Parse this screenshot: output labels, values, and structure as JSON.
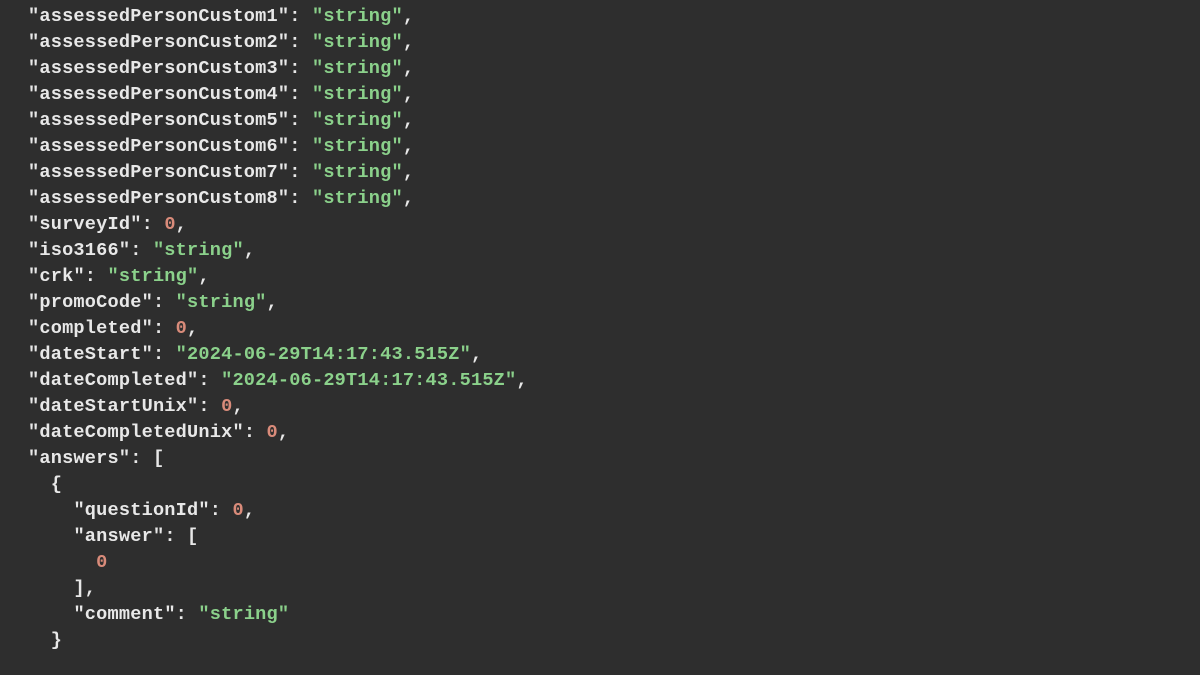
{
  "lines": [
    {
      "indent": 0,
      "key": "assessedPersonCustom1",
      "valueType": "string",
      "value": "string",
      "trailingComma": true
    },
    {
      "indent": 0,
      "key": "assessedPersonCustom2",
      "valueType": "string",
      "value": "string",
      "trailingComma": true
    },
    {
      "indent": 0,
      "key": "assessedPersonCustom3",
      "valueType": "string",
      "value": "string",
      "trailingComma": true
    },
    {
      "indent": 0,
      "key": "assessedPersonCustom4",
      "valueType": "string",
      "value": "string",
      "trailingComma": true
    },
    {
      "indent": 0,
      "key": "assessedPersonCustom5",
      "valueType": "string",
      "value": "string",
      "trailingComma": true
    },
    {
      "indent": 0,
      "key": "assessedPersonCustom6",
      "valueType": "string",
      "value": "string",
      "trailingComma": true
    },
    {
      "indent": 0,
      "key": "assessedPersonCustom7",
      "valueType": "string",
      "value": "string",
      "trailingComma": true
    },
    {
      "indent": 0,
      "key": "assessedPersonCustom8",
      "valueType": "string",
      "value": "string",
      "trailingComma": true
    },
    {
      "indent": 0,
      "key": "surveyId",
      "valueType": "number",
      "value": "0",
      "trailingComma": true
    },
    {
      "indent": 0,
      "key": "iso3166",
      "valueType": "string",
      "value": "string",
      "trailingComma": true
    },
    {
      "indent": 0,
      "key": "crk",
      "valueType": "string",
      "value": "string",
      "trailingComma": true
    },
    {
      "indent": 0,
      "key": "promoCode",
      "valueType": "string",
      "value": "string",
      "trailingComma": true
    },
    {
      "indent": 0,
      "key": "completed",
      "valueType": "number",
      "value": "0",
      "trailingComma": true
    },
    {
      "indent": 0,
      "key": "dateStart",
      "valueType": "string",
      "value": "2024-06-29T14:17:43.515Z",
      "trailingComma": true
    },
    {
      "indent": 0,
      "key": "dateCompleted",
      "valueType": "string",
      "value": "2024-06-29T14:17:43.515Z",
      "trailingComma": true
    },
    {
      "indent": 0,
      "key": "dateStartUnix",
      "valueType": "number",
      "value": "0",
      "trailingComma": true
    },
    {
      "indent": 0,
      "key": "dateCompletedUnix",
      "valueType": "number",
      "value": "0",
      "trailingComma": true
    },
    {
      "indent": 0,
      "key": "answers",
      "valueType": "open-array",
      "value": "[",
      "trailingComma": false
    },
    {
      "indent": 1,
      "key": null,
      "valueType": "open-object",
      "value": "{",
      "trailingComma": false
    },
    {
      "indent": 2,
      "key": "questionId",
      "valueType": "number",
      "value": "0",
      "trailingComma": true
    },
    {
      "indent": 2,
      "key": "answer",
      "valueType": "open-array",
      "value": "[",
      "trailingComma": false
    },
    {
      "indent": 3,
      "key": null,
      "valueType": "number",
      "value": "0",
      "trailingComma": false
    },
    {
      "indent": 2,
      "key": null,
      "valueType": "close-array",
      "value": "]",
      "trailingComma": true
    },
    {
      "indent": 2,
      "key": "comment",
      "valueType": "string",
      "value": "string",
      "trailingComma": false
    },
    {
      "indent": 1,
      "key": null,
      "valueType": "close-object",
      "value": "}",
      "trailingComma": false
    }
  ]
}
